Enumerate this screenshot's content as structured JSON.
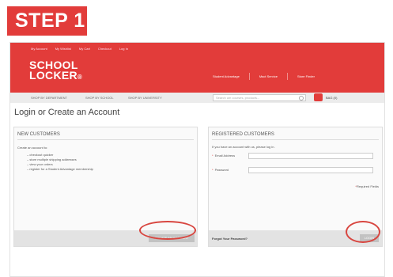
{
  "step_label": "STEP 1",
  "header": {
    "top_links": [
      "My Account",
      "My Wishlist",
      "My Cart",
      "Checkout",
      "Log In"
    ],
    "logo_line1": "SCHOOL",
    "logo_line2": "LOCKER",
    "logo_mark": "®",
    "nav": [
      "Student Advantage",
      "Mact Service",
      "Store Finder"
    ]
  },
  "subnav": {
    "items": [
      "SHOP BY DEPARTMENT",
      "SHOP BY SCHOOL",
      "SHOP BY UNIVERSITY"
    ],
    "search_placeholder": "Search um courses, products...",
    "bag_label": "BAG (0)"
  },
  "page_title": "Login or Create an Account",
  "new_customers": {
    "title": "NEW CUSTOMERS",
    "intro": "Create an account to:",
    "bullets": [
      "checkout quicker",
      "store multiple shipping addresses",
      "view your orders",
      "register for a Student Advantage membership"
    ],
    "button_label": "CREATE AN ACCOUNT"
  },
  "registered_customers": {
    "title": "REGISTERED CUSTOMERS",
    "intro": "If you have an account with us, please log in.",
    "email_label": "Email Address",
    "password_label": "Password",
    "required_marker": "*",
    "required_note": "Required Fields",
    "forgot_link": "Forgot Your Password?",
    "login_label": "LOGIN"
  },
  "colors": {
    "brand_red": "#e23c3a",
    "callout_red": "#d8453f",
    "button_gray": "#c2c2c2"
  }
}
